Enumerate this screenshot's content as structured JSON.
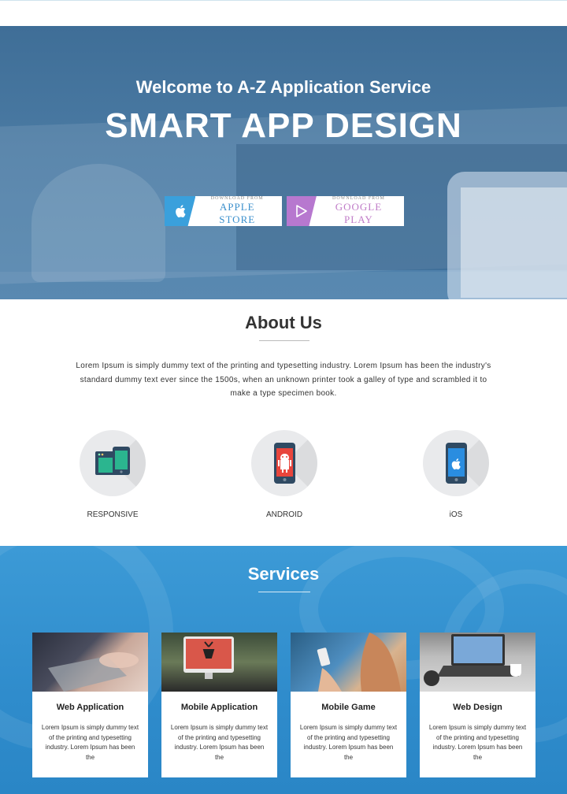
{
  "hero": {
    "welcome": "Welcome to A-Z Application Service",
    "title": "SMART APP DESIGN",
    "apple_small": "DOWNLOAD FROM",
    "apple_big": "APPLE STORE",
    "google_small": "DOWNLOAD FROM",
    "google_big": "GOOGLE PLAY"
  },
  "about": {
    "title": "About Us",
    "text": "Lorem Ipsum is simply dummy text of the printing and typesetting industry. Lorem Ipsum has been the industry's standard dummy text ever since the 1500s, when an unknown printer took a galley of type and scrambled it to make a type specimen book.",
    "features": [
      {
        "label": "RESPONSIVE",
        "icon": "responsive-devices-icon"
      },
      {
        "label": "ANDROID",
        "icon": "android-phone-icon"
      },
      {
        "label": "iOS",
        "icon": "ios-phone-icon"
      }
    ]
  },
  "services": {
    "title": "Services",
    "cards": [
      {
        "title": "Web Application",
        "desc": "Lorem Ipsum is simply dummy text of the printing and typesetting industry. Lorem Ipsum has been the"
      },
      {
        "title": "Mobile Application",
        "desc": "Lorem Ipsum is simply dummy text of the printing and typesetting industry. Lorem Ipsum has been the"
      },
      {
        "title": "Mobile Game",
        "desc": "Lorem Ipsum is simply dummy text of the printing and typesetting industry. Lorem Ipsum has been the"
      },
      {
        "title": "Web Design",
        "desc": "Lorem Ipsum is simply dummy text of the printing and typesetting industry. Lorem Ipsum has been the"
      }
    ]
  },
  "colors": {
    "hero_blue": "#4a7aa3",
    "services_blue": "#2f8ccc",
    "apple_accent": "#3aa0dc",
    "google_accent": "#b778cf"
  }
}
